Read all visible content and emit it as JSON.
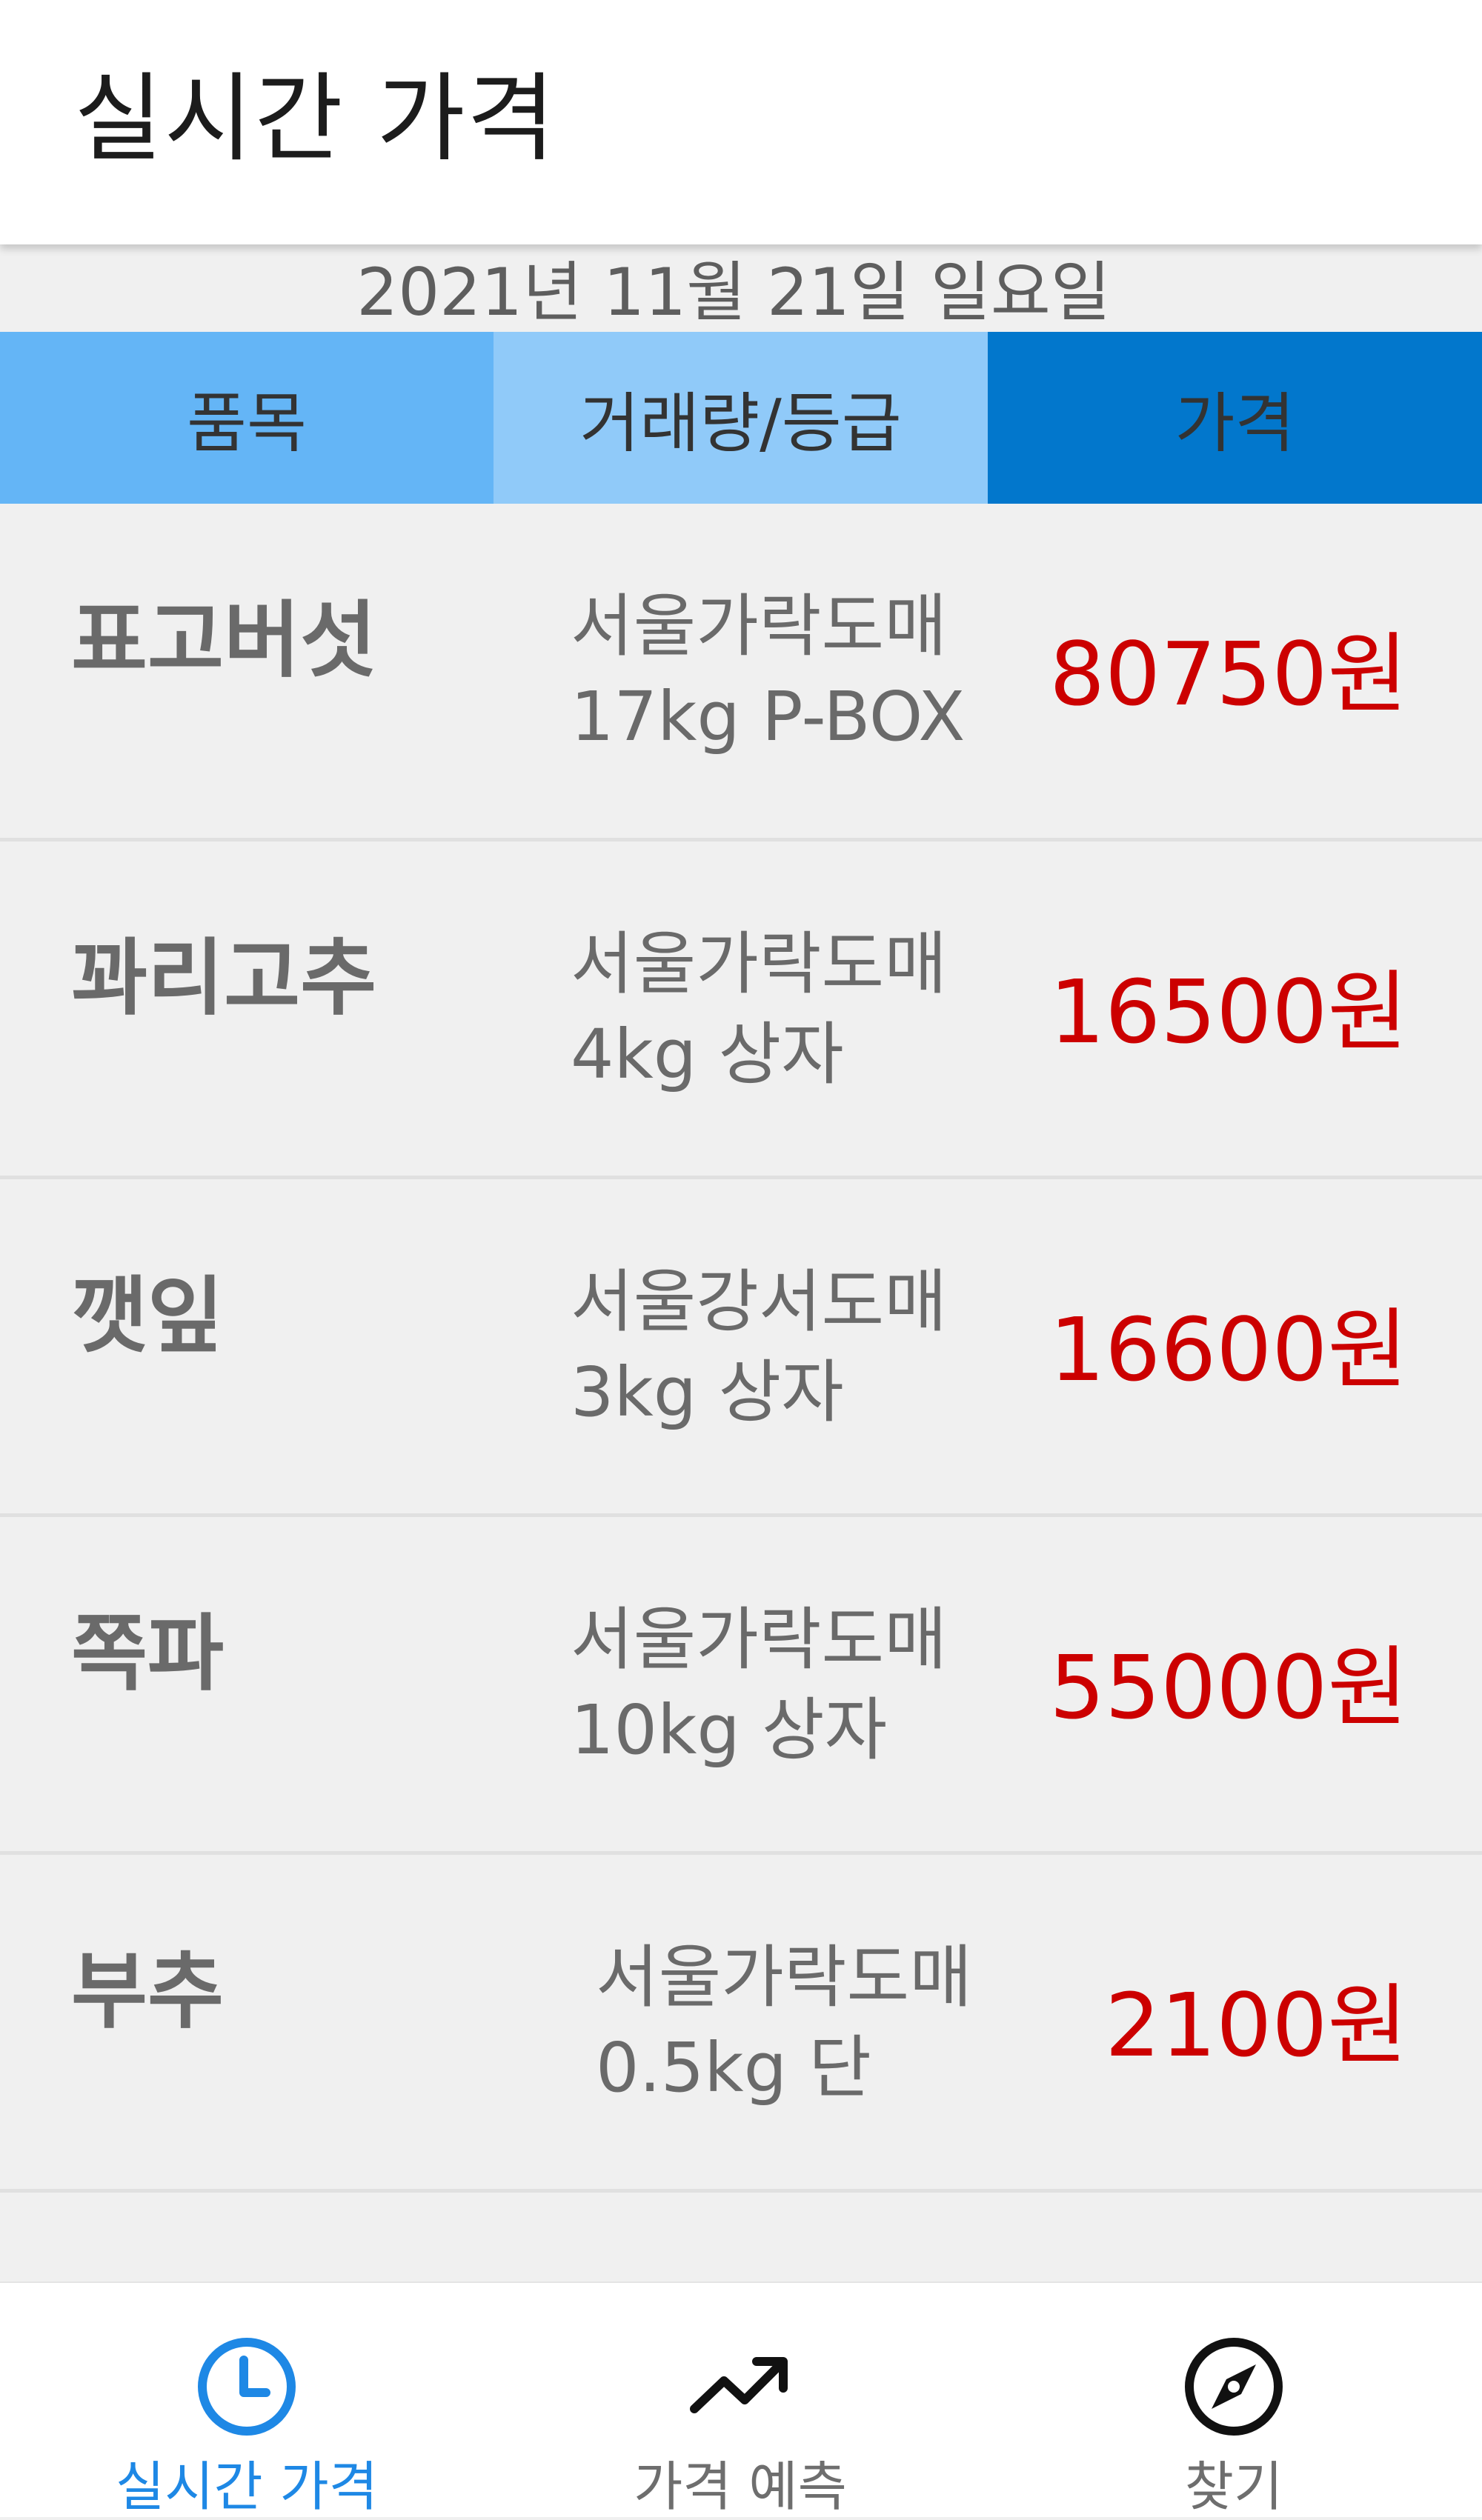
{
  "app_bar": {
    "title": "실시간 가격"
  },
  "date_label": "2021년 11월 21일 일요일",
  "columns": [
    {
      "label": "품목",
      "color": "#64b5f6"
    },
    {
      "label": "거래량/등급",
      "color": "#90caf9"
    },
    {
      "label": "가격",
      "color": "#0277cc"
    }
  ],
  "rows": [
    {
      "name": "표고버섯",
      "market": "서울가락도매",
      "spec": "17kg P-BOX",
      "price": "80750원"
    },
    {
      "name": "꽈리고추",
      "market": "서울가락도매",
      "spec": "4kg 상자",
      "price": "16500원"
    },
    {
      "name": "깻잎",
      "market": "서울강서도매",
      "spec": "3kg 상자",
      "price": "16600원"
    },
    {
      "name": "쪽파",
      "market": "서울가락도매",
      "spec": "10kg 상자",
      "price": "55000원"
    },
    {
      "name": "부추",
      "market": "서울가락도매",
      "spec": "0.5kg 단",
      "price": "2100원"
    }
  ],
  "bottom_nav": [
    {
      "label": "실시간 가격",
      "icon": "clock-icon",
      "active": true
    },
    {
      "label": "가격 예측",
      "icon": "trending-up-icon",
      "active": false
    },
    {
      "label": "찾기",
      "icon": "compass-icon",
      "active": false
    }
  ],
  "colors": {
    "price_text": "#cc0000",
    "active_nav": "#1e88e5",
    "inactive_nav": "#6e6e6e"
  }
}
